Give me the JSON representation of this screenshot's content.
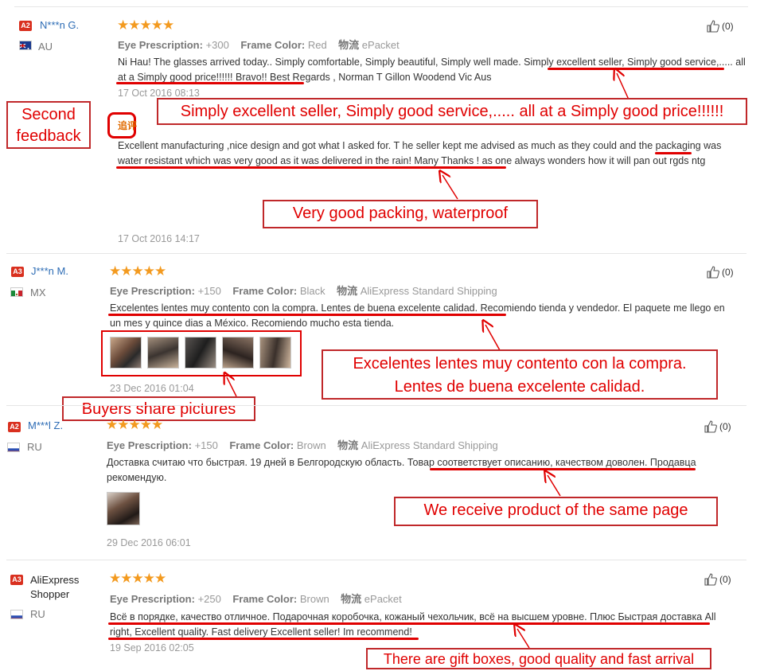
{
  "reviews": [
    {
      "badge": "A2",
      "name": "N***n G.",
      "country": "AU",
      "stars": "★★★★★",
      "attr1_label": "Eye Prescription:",
      "attr1_value": "+300",
      "attr2_label": "Frame Color:",
      "attr2_value": "Red",
      "shipping_label": "物流",
      "shipping_value": "ePacket",
      "text_plain": "Ni Hau! The glasses arrived today.. Simply comfortable, Simply beautiful, Simply well made. ",
      "text_hl": "Simply excellent seller, Simply good service,..... all at a Simply good price!!!!!!",
      "text_tail": " Bravo!! Best Regards , Norman T Gillon Woodend Vic Aus",
      "date": "17 Oct 2016 08:13",
      "helpful": "(0)",
      "followup_tag": "追评",
      "followup_a": "Excellent manufacturing ,nice design and got what I asked for. T he seller kept me advised as much as they could ",
      "followup_hl": "and the packaging was water resistant which was very good as it was delivered in the rain!",
      "followup_b": " Many Thanks ! as one always wonders how it will pan out rgds ntg",
      "followup_date": "17 Oct 2016 14:17"
    },
    {
      "badge": "A3",
      "name": "J***n M.",
      "country": "MX",
      "stars": "★★★★★",
      "attr1_label": "Eye Prescription:",
      "attr1_value": "+150",
      "attr2_label": "Frame Color:",
      "attr2_value": "Black",
      "shipping_label": "物流",
      "shipping_value": "AliExpress Standard Shipping",
      "text_hl": "Excelentes lentes muy contento con la compra. Lentes de buena excelente calidad.",
      "text_tail": " Recomiendo tienda y vendedor. El paquete me llego en un mes y quince dias a México. Recomiendo mucho esta tienda.",
      "date": "23 Dec 2016 01:04",
      "helpful": "(0)"
    },
    {
      "badge": "A2",
      "name": "M***l Z.",
      "country": "RU",
      "stars": "★★★★★",
      "attr1_label": "Eye Prescription:",
      "attr1_value": "+150",
      "attr2_label": "Frame Color:",
      "attr2_value": "Brown",
      "shipping_label": "物流",
      "shipping_value": "AliExpress Standard Shipping",
      "text_plain": "Доставка считаю что быстрая. 19 дней в Белгородскую область. ",
      "text_hl": "Товар соответствует описанию, качеством доволен.",
      "text_tail": " Продавца рекомендую.",
      "date": "29 Dec 2016 06:01",
      "helpful": "(0)"
    },
    {
      "badge": "A3",
      "name": "AliExpress Shopper",
      "country": "RU",
      "stars": "★★★★★",
      "attr1_label": "Eye Prescription:",
      "attr1_value": "+250",
      "attr2_label": "Frame Color:",
      "attr2_value": "Brown",
      "shipping_label": "物流",
      "shipping_value": "ePacket",
      "text_hl": "Всё в порядке, качество отличное. Подарочная коробочка, кожаный чехольчик, всё на высшем уровне. Плюс Быстрая доставка All right, Excellent quality. Fast delivery Excellent seller!",
      "text_tail": " Im recommend!",
      "date": "19 Sep 2016 02:05",
      "helpful": "(0)"
    }
  ],
  "callouts": {
    "second_feedback": "Second feedback",
    "c1": "Simply excellent seller, Simply good service,..... all at a Simply good price!!!!!!",
    "c2": "Very good packing, waterproof",
    "c3": "Excelentes lentes muy contento con la compra. Lentes de buena excelente calidad.",
    "c4": "Buyers share pictures",
    "c5": "We receive product of the same page",
    "c6": "There are gift boxes, good quality and fast arrival"
  },
  "colors": {
    "accent_red": "#e00000",
    "star": "#f39a1f",
    "link": "#2d6cb5",
    "badge": "#d9301f"
  }
}
